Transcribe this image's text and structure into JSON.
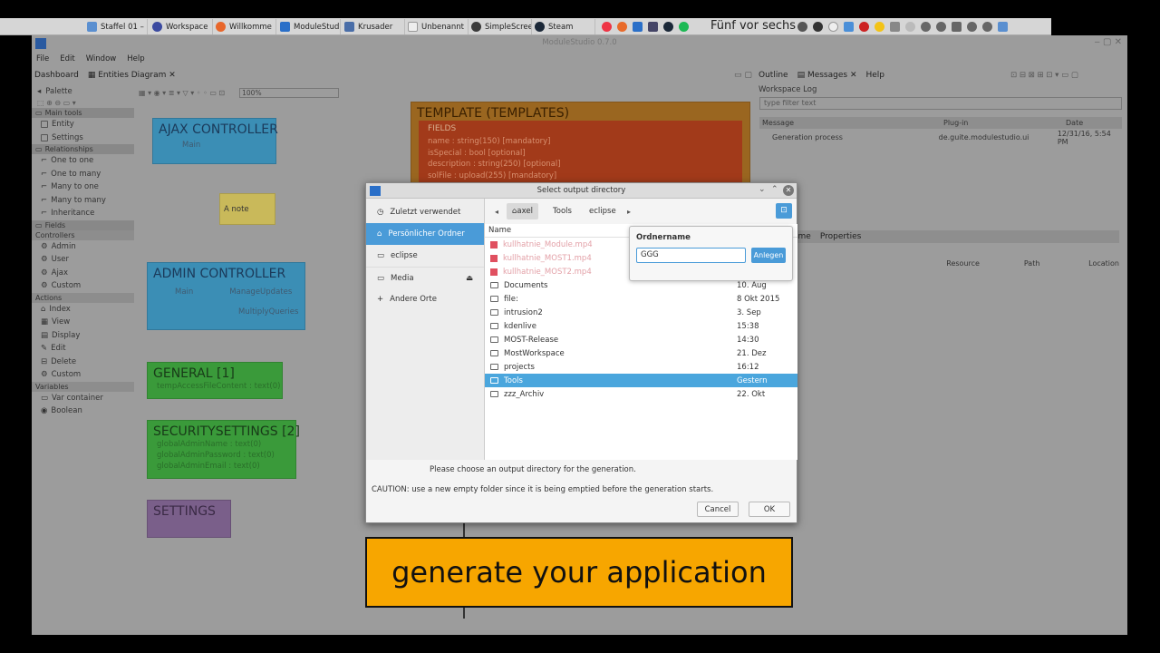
{
  "taskbar": {
    "tasks": [
      "Staffel 01 –",
      "Workspace",
      "Willkomme",
      "ModuleStud",
      "Krusader",
      "Unbenannt",
      "SimpleScree",
      "Steam"
    ],
    "clock": "Fünf vor sechs"
  },
  "app": {
    "title": "ModuleStudio 0.7.0",
    "menu": [
      "File",
      "Edit",
      "Window",
      "Help"
    ],
    "left_tabs": [
      "Dashboard",
      "Entities Diagram"
    ],
    "zoom": "100%",
    "palette": {
      "title": "Palette",
      "sections": [
        {
          "label": "Main tools",
          "items": [
            "Entity",
            "Settings"
          ]
        },
        {
          "label": "Relationships",
          "items": [
            "One to one",
            "One to many",
            "Many to one",
            "Many to many",
            "Inheritance"
          ]
        },
        {
          "label": "Fields",
          "items": []
        },
        {
          "label": "Controllers",
          "items": [
            "Admin",
            "User",
            "Ajax",
            "Custom"
          ]
        },
        {
          "label": "Actions",
          "items": [
            "Index",
            "View",
            "Display",
            "Edit",
            "Delete",
            "Custom"
          ]
        },
        {
          "label": "Variables",
          "items": [
            "Var container",
            "Boolean"
          ]
        }
      ]
    },
    "diagram": {
      "ajax": {
        "title": "AJAX CONTROLLER",
        "rows": [
          "Main"
        ]
      },
      "note": "A note",
      "admin": {
        "title": "ADMIN CONTROLLER",
        "rows": [
          "Main",
          "ManageUpdates",
          "MultiplyQueries"
        ]
      },
      "general": {
        "title": "GENERAL [1]",
        "rows": [
          "tempAccessFileContent : text(0)"
        ]
      },
      "security": {
        "title": "SECURITYSETTINGS [2]",
        "rows": [
          "globalAdminName : text(0)",
          "globalAdminPassword : text(0)",
          "globalAdminEmail : text(0)"
        ]
      },
      "settings": {
        "title": "SETTINGS"
      },
      "template": {
        "title": "TEMPLATE (TEMPLATES)",
        "section": "FIELDS",
        "rows": [
          "name : string(150) [mandatory]",
          "isSpecial : bool [optional]",
          "description : string(250) [optional]",
          "solFile : upload(255) [mandatory]"
        ]
      }
    },
    "right_tabs": [
      "Outline",
      "Messages",
      "Help"
    ],
    "workspace_log": "Workspace Log",
    "filter_placeholder": "type filter text",
    "log_columns": [
      "Message",
      "Plug-in",
      "Date"
    ],
    "log_row": {
      "message": "Generation process",
      "plugin": "de.guite.modulestudio.ui",
      "date": "12/31/16, 5:54 PM"
    },
    "lower_tabs": [
      "ame",
      "Properties"
    ],
    "lower_columns": [
      "Resource",
      "Path",
      "Location"
    ]
  },
  "dialog": {
    "title": "Select output directory",
    "places": [
      "Zuletzt verwendet",
      "Persönlicher Ordner",
      "eclipse",
      "Media",
      "Andere Orte"
    ],
    "path": [
      "axel",
      "Tools",
      "eclipse"
    ],
    "columns": [
      "Name"
    ],
    "files": [
      {
        "name": "kullhatnie_Module.mp4",
        "date": ""
      },
      {
        "name": "kullhatnie_MOST1.mp4",
        "date": ""
      },
      {
        "name": "kullhatnie_MOST2.mp4",
        "date": ""
      },
      {
        "name": "Documents",
        "date": "10. Aug"
      },
      {
        "name": "file:",
        "date": "8 Okt 2015"
      },
      {
        "name": "intrusion2",
        "date": "3. Sep"
      },
      {
        "name": "kdenlive",
        "date": "15:38"
      },
      {
        "name": "MOST-Release",
        "date": "14:30"
      },
      {
        "name": "MostWorkspace",
        "date": "21. Dez"
      },
      {
        "name": "projects",
        "date": "16:12"
      },
      {
        "name": "Tools",
        "date": "Gestern"
      },
      {
        "name": "zzz_Archiv",
        "date": "22. Okt"
      }
    ],
    "folder_label": "Ordnername",
    "folder_value": "GGG",
    "create_label": "Anlegen",
    "info": "Please choose an output directory for the generation.",
    "caution": "CAUTION: use a new empty folder since it is being emptied before the generation starts.",
    "cancel": "Cancel",
    "ok": "OK"
  },
  "caption": "generate your application"
}
